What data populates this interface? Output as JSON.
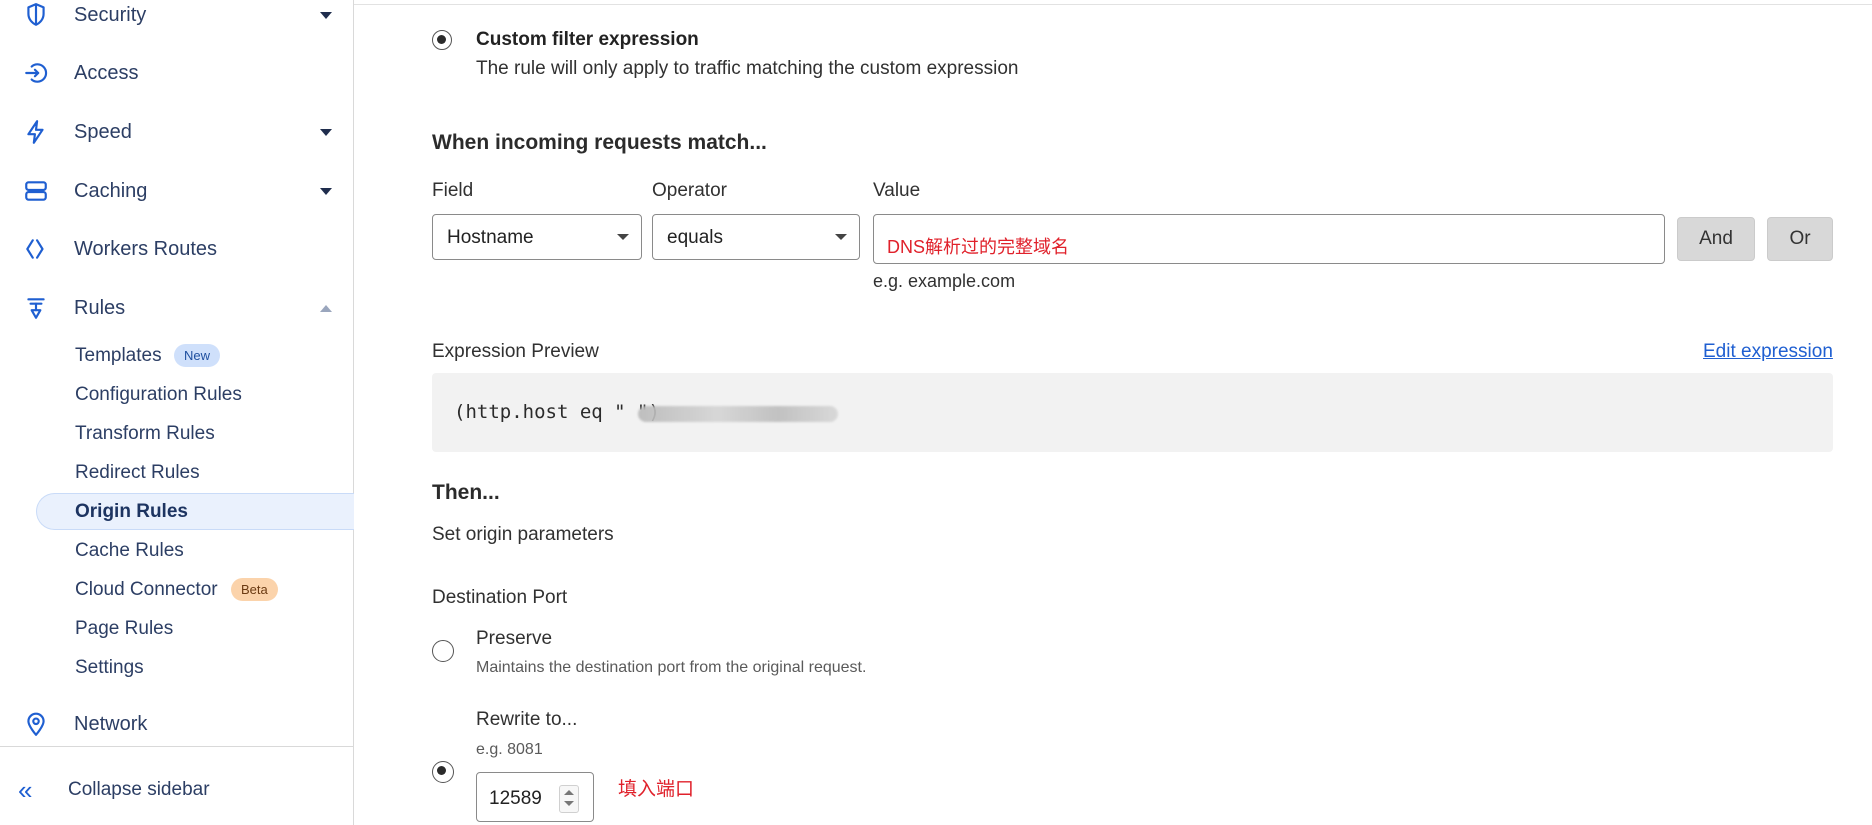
{
  "sidebar": {
    "items": [
      {
        "label": "Security",
        "icon": "shield-icon"
      },
      {
        "label": "Access",
        "icon": "access-icon"
      },
      {
        "label": "Speed",
        "icon": "lightning-icon"
      },
      {
        "label": "Caching",
        "icon": "storage-icon"
      },
      {
        "label": "Workers Routes",
        "icon": "workers-icon"
      },
      {
        "label": "Rules",
        "icon": "rules-icon"
      },
      {
        "label": "Network",
        "icon": "location-pin-icon"
      }
    ],
    "rules_subitems": [
      {
        "label": "Templates",
        "badge": "New"
      },
      {
        "label": "Configuration Rules"
      },
      {
        "label": "Transform Rules"
      },
      {
        "label": "Redirect Rules"
      },
      {
        "label": "Origin Rules",
        "active": true
      },
      {
        "label": "Cache Rules"
      },
      {
        "label": "Cloud Connector",
        "badge": "Beta"
      },
      {
        "label": "Page Rules"
      },
      {
        "label": "Settings"
      }
    ],
    "collapse_label": "Collapse sidebar"
  },
  "main": {
    "filter_option": {
      "title": "Custom filter expression",
      "description": "The rule will only apply to traffic matching the custom expression",
      "selected": true
    },
    "match_heading": "When incoming requests match...",
    "field_label": "Field",
    "operator_label": "Operator",
    "value_label": "Value",
    "field_value": "Hostname",
    "operator_value": "equals",
    "value_annotation": "DNS解析过的完整域名",
    "value_hint": "e.g. example.com",
    "and_button": "And",
    "or_button": "Or",
    "expression_preview_label": "Expression Preview",
    "edit_expression_link": "Edit expression",
    "expression_text": "(http.host eq \"                    \")",
    "then_heading": "Then...",
    "then_description": "Set origin parameters",
    "destination_port_label": "Destination Port",
    "preserve": {
      "title": "Preserve",
      "description": "Maintains the destination port from the original request.",
      "selected": false
    },
    "rewrite": {
      "title": "Rewrite to...",
      "hint": "e.g. 8081",
      "value": "12589",
      "annotation": "填入端口",
      "selected": true
    }
  },
  "colors": {
    "accent": "#1f5fd1",
    "annotation": "#e0212b",
    "active_bg": "#eaf1fd"
  }
}
